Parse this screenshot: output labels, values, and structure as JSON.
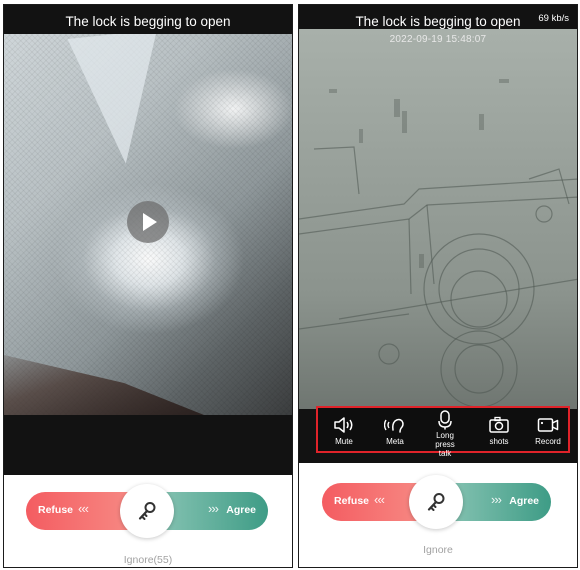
{
  "left_screen": {
    "title": "The lock is begging to open",
    "slider": {
      "refuse_label": "Refuse",
      "agree_label": "Agree"
    },
    "ignore_label": "Ignore(55)"
  },
  "right_screen": {
    "title": "The lock is begging to open",
    "speed": "69 kb/s",
    "timestamp": "2022-09-19 15:48:07",
    "toolbar": {
      "mute": "Mute",
      "meta": "Meta",
      "talk": [
        "Long",
        "press",
        "talk"
      ],
      "shots": "shots",
      "record": "Record"
    },
    "slider": {
      "refuse_label": "Refuse",
      "agree_label": "Agree"
    },
    "ignore_label": "Ignore"
  },
  "icons": {
    "play": "play-icon",
    "key": "key-icon",
    "mute": "speaker-icon",
    "meta": "voice-changer-icon",
    "talk": "microphone-icon",
    "shots": "camera-icon",
    "record": "video-camera-icon"
  },
  "colors": {
    "refuse": "#f45c61",
    "agree": "#3e9c86",
    "highlight": "#e0232a"
  }
}
